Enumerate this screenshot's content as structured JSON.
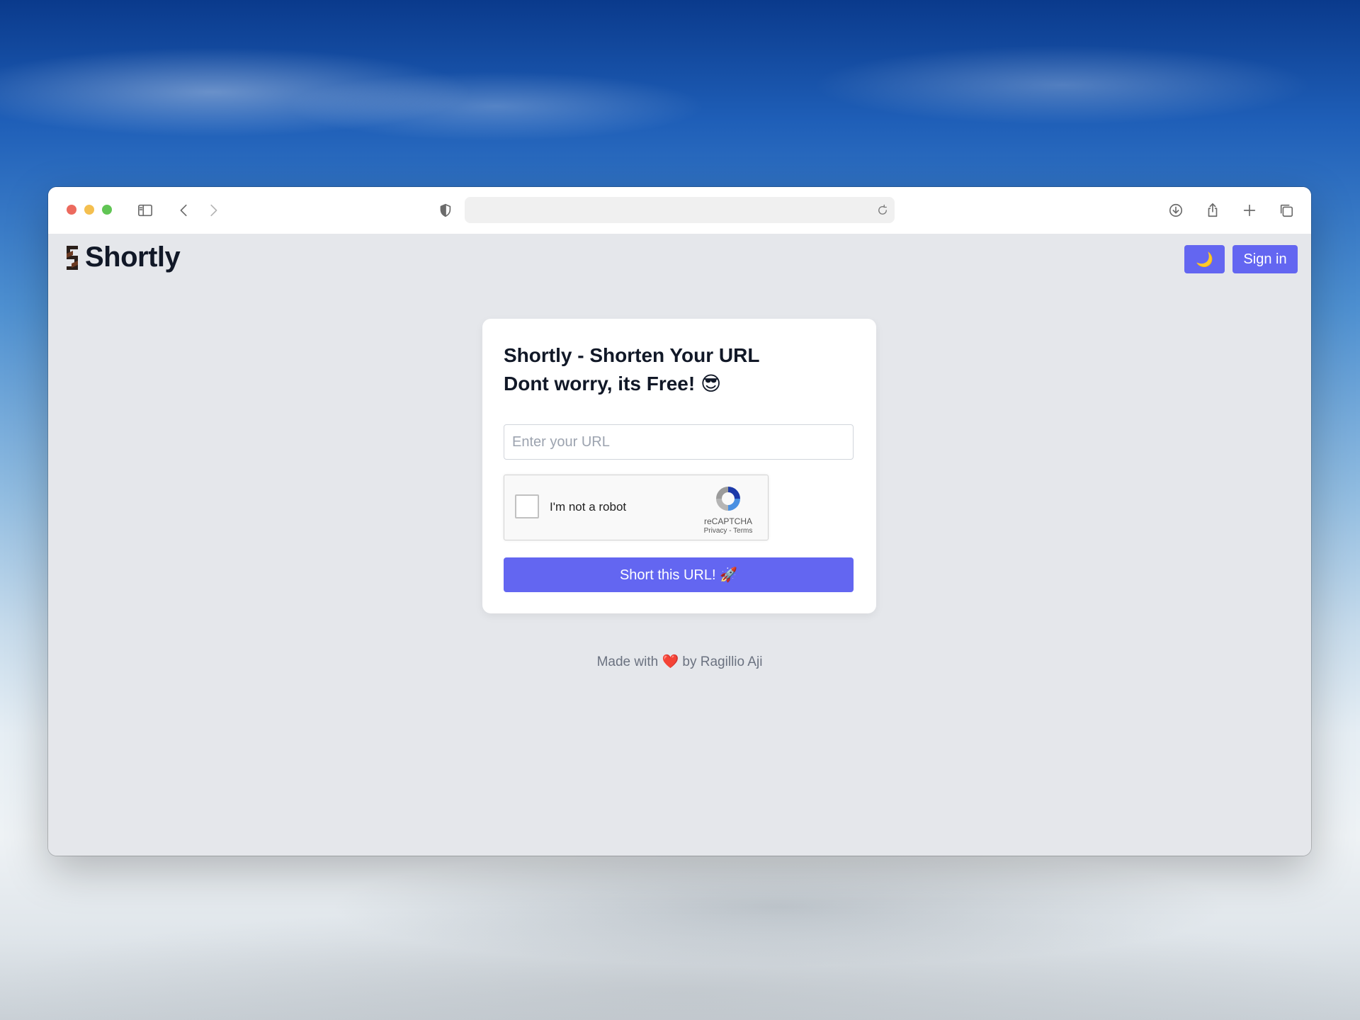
{
  "browser": {
    "address_value": ""
  },
  "header": {
    "logo_text": "Shortly",
    "theme_toggle_label": "🌙",
    "signin_label": "Sign in"
  },
  "form": {
    "title_line1": "Shortly - Shorten Your URL",
    "title_line2": "Dont worry, its Free! 😎",
    "url_placeholder": "Enter your URL",
    "url_value": "",
    "captcha_label": "I'm not a robot",
    "captcha_brand": "reCAPTCHA",
    "captcha_links": "Privacy - Terms",
    "submit_label": "Short this URL! 🚀"
  },
  "footer": {
    "prefix": "Made with",
    "heart": "❤️",
    "suffix": "by Ragillio Aji"
  },
  "colors": {
    "accent": "#6366f1",
    "page_bg": "#e5e7eb"
  },
  "icons": [
    "sidebar-icon",
    "back-icon",
    "forward-icon",
    "shield-icon",
    "reload-icon",
    "download-icon",
    "share-icon",
    "new-tab-icon",
    "tabs-overview-icon",
    "shortly-logo-icon",
    "recaptcha-icon"
  ]
}
